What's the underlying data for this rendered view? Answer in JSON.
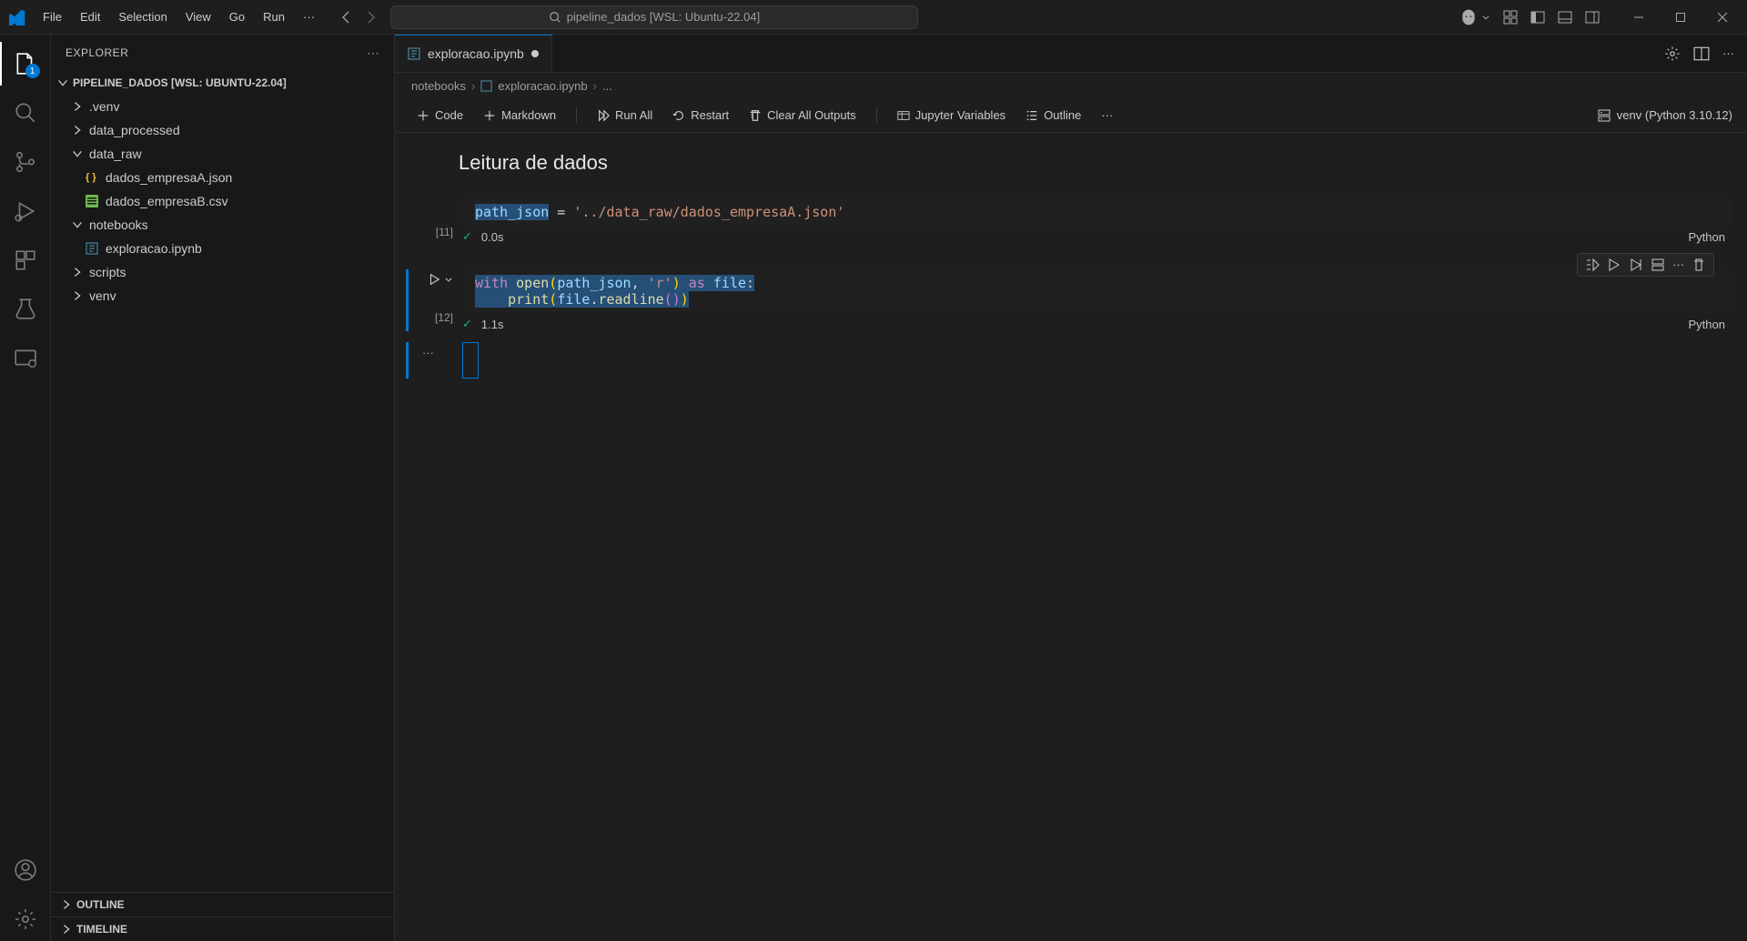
{
  "titlebar": {
    "menus": [
      "File",
      "Edit",
      "Selection",
      "View",
      "Go",
      "Run"
    ],
    "search": "pipeline_dados [WSL: Ubuntu-22.04]"
  },
  "activitybar": {
    "explorer_badge": "1"
  },
  "sidebar": {
    "title": "EXPLORER",
    "project": "PIPELINE_DADOS [WSL: UBUNTU-22.04]",
    "tree": [
      {
        "name": ".venv",
        "type": "folder",
        "expanded": false,
        "indent": 1
      },
      {
        "name": "data_processed",
        "type": "folder",
        "expanded": false,
        "indent": 1
      },
      {
        "name": "data_raw",
        "type": "folder",
        "expanded": true,
        "indent": 1
      },
      {
        "name": "dados_empresaA.json",
        "type": "json",
        "indent": 2
      },
      {
        "name": "dados_empresaB.csv",
        "type": "csv",
        "indent": 2
      },
      {
        "name": "notebooks",
        "type": "folder",
        "expanded": true,
        "indent": 1
      },
      {
        "name": "exploracao.ipynb",
        "type": "ipynb",
        "indent": 2
      },
      {
        "name": "scripts",
        "type": "folder",
        "expanded": false,
        "indent": 1
      },
      {
        "name": "venv",
        "type": "folder",
        "expanded": false,
        "indent": 1
      }
    ],
    "outline": "OUTLINE",
    "timeline": "TIMELINE"
  },
  "tab": {
    "name": "exploracao.ipynb"
  },
  "breadcrumb": {
    "a": "notebooks",
    "b": "exploracao.ipynb",
    "c": "..."
  },
  "nb_toolbar": {
    "code": "Code",
    "markdown": "Markdown",
    "run_all": "Run All",
    "restart": "Restart",
    "clear": "Clear All Outputs",
    "variables": "Jupyter Variables",
    "outline": "Outline",
    "kernel": "venv (Python 3.10.12)"
  },
  "notebook": {
    "md_title": "Leitura de dados",
    "cell1": {
      "exec": "[11]",
      "time": "0.0s",
      "lang": "Python",
      "code_var": "path_json",
      "code_eq": " = ",
      "code_str": "'../data_raw/dados_empresaA.json'"
    },
    "cell2": {
      "exec": "[12]",
      "time": "1.1s",
      "lang": "Python",
      "line1_with": "with",
      "line1_open": " open",
      "line1_p1": "(",
      "line1_var": "path_json",
      "line1_comma": ", ",
      "line1_mode": "'r'",
      "line1_p2": ")",
      "line1_as": " as ",
      "line1_file": "file",
      "line1_colon": ":",
      "line2_indent": "    ",
      "line2_print": "print",
      "line2_p1": "(",
      "line2_file": "file",
      "line2_dot": ".",
      "line2_read": "readline",
      "line2_p2": "(",
      "line2_p3": ")",
      "line2_p4": ")"
    }
  }
}
